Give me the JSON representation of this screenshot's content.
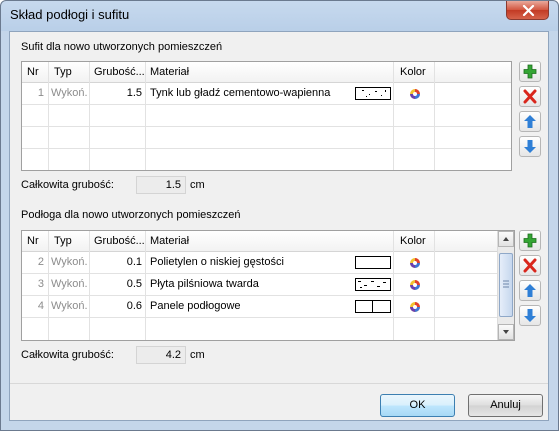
{
  "window": {
    "title": "Skład podłogi i sufitu"
  },
  "columns": [
    "Nr",
    "Typ",
    "Grubość...",
    "Materiał",
    "Kolor"
  ],
  "ceiling": {
    "section_label": "Sufit dla nowo utworzonych pomieszczeń",
    "rows": [
      {
        "nr": "1",
        "typ": "Wykoń.",
        "grubosc": "1.5",
        "material": "Tynk lub gładź cementowo-wapienna",
        "pattern": "dotted"
      }
    ],
    "total_label": "Całkowita grubość:",
    "total_value": "1.5",
    "unit": "cm"
  },
  "floor": {
    "section_label": "Podłoga dla nowo utworzonych pomieszczeń",
    "rows": [
      {
        "nr": "2",
        "typ": "Wykoń.",
        "grubosc": "0.1",
        "material": "Polietylen o niskiej gęstości",
        "pattern": "blank"
      },
      {
        "nr": "3",
        "typ": "Wykoń.",
        "grubosc": "0.5",
        "material": "Płyta pilśniowa twarda",
        "pattern": "dashed"
      },
      {
        "nr": "4",
        "typ": "Wykoń.",
        "grubosc": "0.6",
        "material": "Panele podłogowe",
        "pattern": "split"
      }
    ],
    "total_label": "Całkowita grubość:",
    "total_value": "4.2",
    "unit": "cm"
  },
  "buttons": {
    "ok": "OK",
    "cancel": "Anuluj"
  },
  "icons": {
    "add": "add-icon",
    "delete": "delete-icon",
    "up": "arrow-up-icon",
    "down": "arrow-down-icon",
    "color": "color-picker-icon",
    "close": "close-icon"
  },
  "colors": {
    "add": "#2e9b2e",
    "delete": "#d9261c",
    "arrow": "#2f7fd6",
    "accent": "#3c7fb1"
  }
}
